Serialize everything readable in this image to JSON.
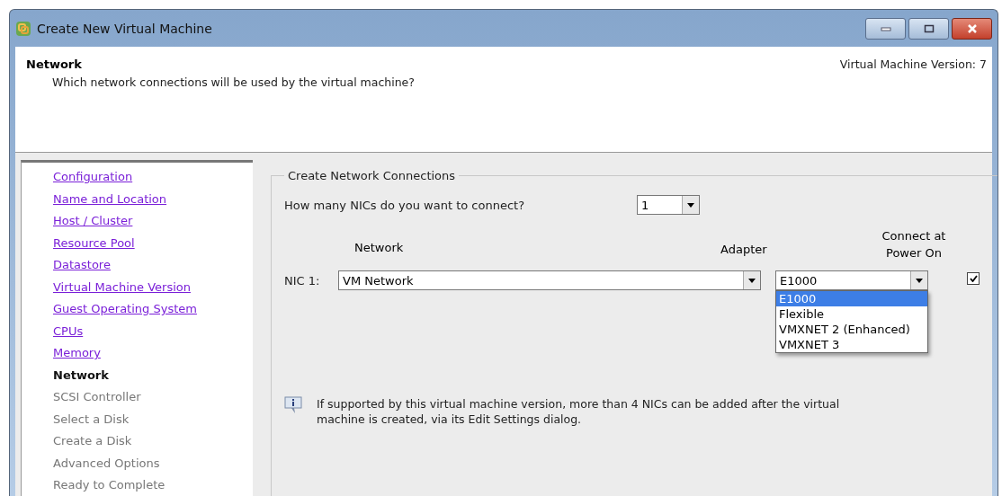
{
  "window": {
    "title": "Create New Virtual Machine"
  },
  "header": {
    "title": "Network",
    "subtitle": "Which network connections will be used by the virtual machine?",
    "version": "Virtual Machine Version: 7"
  },
  "steps": [
    {
      "label": "Configuration",
      "kind": "done"
    },
    {
      "label": "Name and Location",
      "kind": "done"
    },
    {
      "label": "Host / Cluster",
      "kind": "done"
    },
    {
      "label": "Resource Pool",
      "kind": "done"
    },
    {
      "label": "Datastore",
      "kind": "done"
    },
    {
      "label": "Virtual Machine Version",
      "kind": "done"
    },
    {
      "label": "Guest Operating System",
      "kind": "done"
    },
    {
      "label": "CPUs",
      "kind": "done"
    },
    {
      "label": "Memory",
      "kind": "done"
    },
    {
      "label": "Network",
      "kind": "current"
    },
    {
      "label": "SCSI Controller",
      "kind": "pending"
    },
    {
      "label": "Select a Disk",
      "kind": "pending"
    },
    {
      "label": "Create a Disk",
      "kind": "pending"
    },
    {
      "label": "Advanced Options",
      "kind": "pending"
    },
    {
      "label": "Ready to Complete",
      "kind": "pending"
    }
  ],
  "group": {
    "title": "Create Network Connections",
    "nic_count": {
      "label": "How many NICs do you want to connect?",
      "value": "1"
    },
    "columns": {
      "network": "Network",
      "adapter": "Adapter",
      "connect": "Connect at Power On"
    },
    "nics": [
      {
        "label": "NIC 1:",
        "network": "VM Network",
        "adapter": "E1000",
        "connect": true,
        "adapter_options": [
          {
            "label": "E1000",
            "selected": true
          },
          {
            "label": "Flexible",
            "selected": false
          },
          {
            "label": "VMXNET 2 (Enhanced)",
            "selected": false
          },
          {
            "label": "VMXNET 3",
            "selected": false
          }
        ]
      }
    ],
    "note": "If supported by this virtual machine version, more than 4 NICs can be added after the virtual machine is created, via its Edit Settings dialog."
  }
}
